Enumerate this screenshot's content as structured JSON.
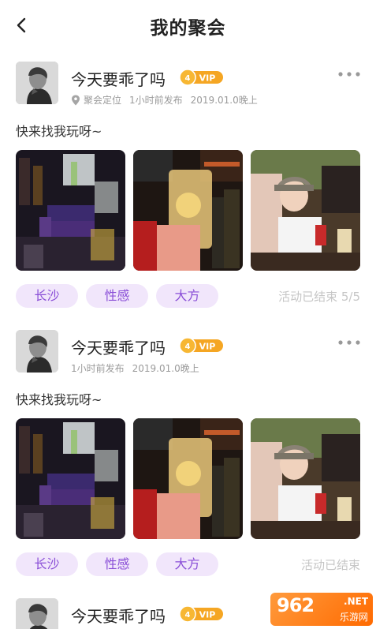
{
  "header": {
    "title": "我的聚会",
    "back_icon": "chevron-left-icon"
  },
  "posts": [
    {
      "username": "今天要乖了吗",
      "vip_label": "VIP",
      "vip_level": "4",
      "location": "聚会定位",
      "posted_ago": "1小时前发布",
      "event_time": "2019.01.0晚上",
      "text": "快来找我玩呀~",
      "tags": [
        "长沙",
        "性感",
        "大方"
      ],
      "status": "活动已结束 5/5"
    },
    {
      "username": "今天要乖了吗",
      "vip_label": "VIP",
      "vip_level": "4",
      "posted_ago": "1小时前发布",
      "event_time": "2019.01.0晚上",
      "text": "快来找我玩呀~",
      "tags": [
        "长沙",
        "性感",
        "大方"
      ],
      "status": "活动已结束"
    },
    {
      "username": "今天要乖了吗",
      "vip_label": "VIP",
      "vip_level": "4"
    }
  ],
  "watermark": {
    "big": "962",
    "net": ".NET",
    "cn": "乐游网"
  },
  "colors": {
    "tag_bg": "#f1e6fb",
    "tag_text": "#8a4fd7",
    "vip_orange": "#f5a623",
    "status_gray": "#c6c6c6"
  }
}
